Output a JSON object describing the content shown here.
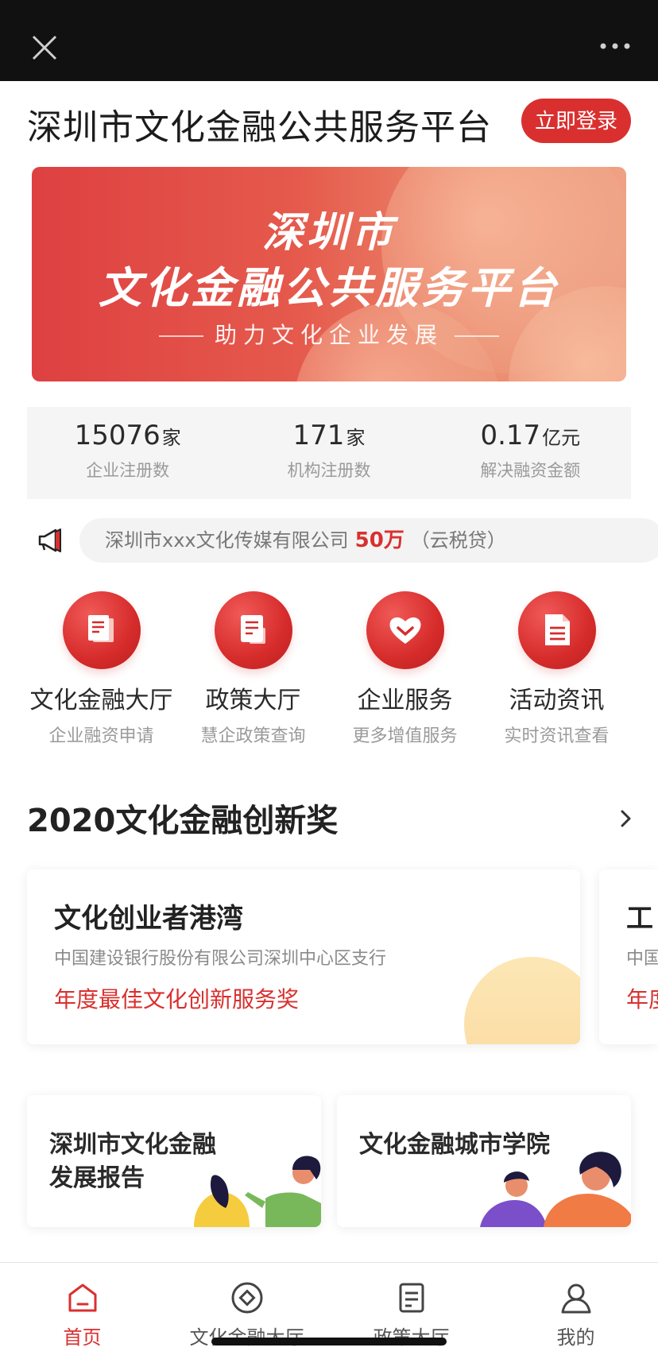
{
  "header": {
    "title": "深圳市文化金融公共服务平台",
    "login_label": "立即登录"
  },
  "banner": {
    "line1": "深圳市",
    "line2": "文化金融公共服务平台",
    "line3": "助力文化企业发展"
  },
  "stats": [
    {
      "value": "15076",
      "unit": "家",
      "label": "企业注册数"
    },
    {
      "value": "171",
      "unit": "家",
      "label": "机构注册数"
    },
    {
      "value": "0.17",
      "unit": "亿元",
      "label": "解决融资金额"
    }
  ],
  "notice": {
    "company": "深圳市xxx文化传媒有限公司",
    "amount": "50万",
    "product": "（云税贷）"
  },
  "services": [
    {
      "title": "文化金融大厅",
      "subtitle": "企业融资申请",
      "icon": "document-stack-icon"
    },
    {
      "title": "政策大厅",
      "subtitle": "慧企政策查询",
      "icon": "document-icon"
    },
    {
      "title": "企业服务",
      "subtitle": "更多增值服务",
      "icon": "heart-icon"
    },
    {
      "title": "活动资讯",
      "subtitle": "实时资讯查看",
      "icon": "news-icon"
    }
  ],
  "awards_section": {
    "title": "2020文化金融创新奖"
  },
  "awards": [
    {
      "name": "文化创业者港湾",
      "org": "中国建设银行股份有限公司深圳中心区支行",
      "prize": "年度最佳文化创新服务奖"
    },
    {
      "name": "工",
      "org": "中国",
      "prize": "年度"
    }
  ],
  "info_cards": [
    {
      "line1": "深圳市文化金融",
      "line2": "发展报告"
    },
    {
      "line1": "文化金融城市学院"
    }
  ],
  "tabbar": [
    {
      "label": "首页",
      "icon": "home-icon",
      "active": true
    },
    {
      "label": "文化金融大厅",
      "icon": "finance-hall-icon",
      "active": false
    },
    {
      "label": "政策大厅",
      "icon": "policy-hall-icon",
      "active": false
    },
    {
      "label": "我的",
      "icon": "profile-icon",
      "active": false
    }
  ],
  "colors": {
    "accent": "#d9302f",
    "topbar": "#111111",
    "stats_bg": "#f5f5f5",
    "award_deco": "#fce7b5"
  }
}
